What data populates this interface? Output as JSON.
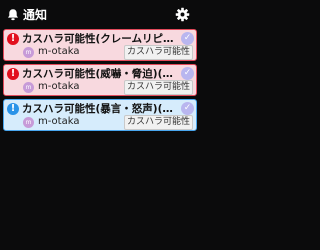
{
  "header": {
    "title": "通知",
    "bell_icon": "bell-icon",
    "settings_icon": "gear-icon"
  },
  "notifications": [
    {
      "type": "alert",
      "badge": "!",
      "title": "カスハラ可能性(クレームリピ…",
      "avatar": "m",
      "user": "m-otaka",
      "tag": "カスハラ可能性"
    },
    {
      "type": "alert",
      "badge": "!",
      "title": "カスハラ可能性(威嚇・脅迫)(…",
      "avatar": "m",
      "user": "m-otaka",
      "tag": "カスハラ可能性"
    },
    {
      "type": "info",
      "badge": "!",
      "title": "カスハラ可能性(暴言・怒声)(…",
      "avatar": "m",
      "user": "m-otaka",
      "tag": "カスハラ可能性"
    }
  ],
  "colors": {
    "background": "#0b0b0c",
    "alert_border": "#e24a5b",
    "alert_fill": "#f8d9df",
    "info_border": "#49a6ee",
    "info_fill": "#d6ecfc",
    "check": "#b9b6ef"
  }
}
